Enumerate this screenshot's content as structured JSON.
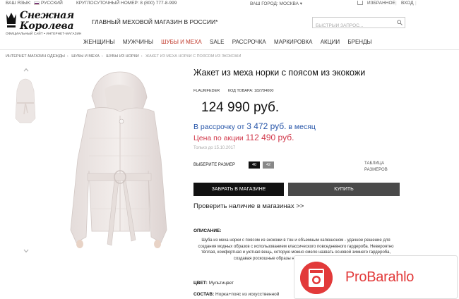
{
  "topbar": {
    "region_label": "ВАШ ЯЗЫК:",
    "language": "РУССКИЙ",
    "phone": "КРУГЛОСУТОЧНЫЙ НОМЕР: 8 (800) 777-8-999",
    "city": "ВАШ ГОРОД: МОСКВА ▾",
    "wishlist": "ИЗБРАННОЕ",
    "login": "ВХОД"
  },
  "header": {
    "logo_line1": "Снежная",
    "logo_line2": "Королева",
    "logo_sub": "ОФИЦИАЛЬНЫЙ САЙТ • ИНТЕРНЕТ-МАГАЗИН",
    "tagline": "ГЛАВНЫЙ МЕХОВОЙ МАГАЗИН В РОССИИ*",
    "search_placeholder": "БЫСТРЫЙ ЗАПРОС..."
  },
  "nav": {
    "items": [
      "ЖЕНЩИНЫ",
      "МУЖЧИНЫ",
      "ШУБЫ И МЕХА",
      "SALE",
      "РАССРОЧКА",
      "МАРКИРОВКА",
      "АКЦИИ",
      "БРЕНДЫ"
    ]
  },
  "breadcrumb": {
    "items": [
      "ИНТЕРНЕТ-МАГАЗИН ОДЕЖДЫ",
      "ШУБЫ И МЕХА",
      "ШУБЫ ИЗ НОРКИ"
    ],
    "current": "ЖАКЕТ ИЗ МЕХА НОРКИ С ПОЯСОМ ИЗ ЭКОКОЖИ"
  },
  "product": {
    "title": "Жакет из меха норки с поясом из экокожи",
    "brand": "FLAUMFEDER",
    "code": "КОД ТОВАРА: 182784000",
    "price": "124 990 руб.",
    "installment_prefix": "В рассрочку от ",
    "installment_amount": "3 472 руб.",
    "installment_suffix": " в месяц",
    "sale_prefix": "Цена по акции ",
    "sale_amount": "112 490 руб.",
    "until": "Только до 15.10.2017",
    "size_label": "ВЫБЕРИТЕ РАЗМЕР",
    "sizes": [
      "40",
      "42"
    ],
    "size_table_line1": "ТАБЛИЦА",
    "size_table_line2": "РАЗМЕРОВ",
    "reserve_button": "ЗАБРАТЬ В МАГАЗИНЕ",
    "buy_button": "КУПИТЬ",
    "check_link": "Проверить наличие в магазинах >>",
    "desc_heading": "ОПИСАНИЕ:",
    "desc_text": "Шуба из меха норки с поясом из экокожи в тон и объемным капюшоном - удачное решение для создания модных образов с использованием классического повседневного гардероба. Невероятно тёплая, комфортная и уютная вещь, которую можно смело назвать основой зимнего гардероба, создавая роскошные образы на будние дни, и яркие выходные",
    "color_label": "ЦВЕТ:",
    "color_value": "Мультицвет",
    "comp_label": "СОСТАВ:",
    "comp_value": "Норка+пояс из искусственной"
  },
  "overlay": {
    "brand": "ProBarahlo",
    "accent": "#e23a3a"
  }
}
